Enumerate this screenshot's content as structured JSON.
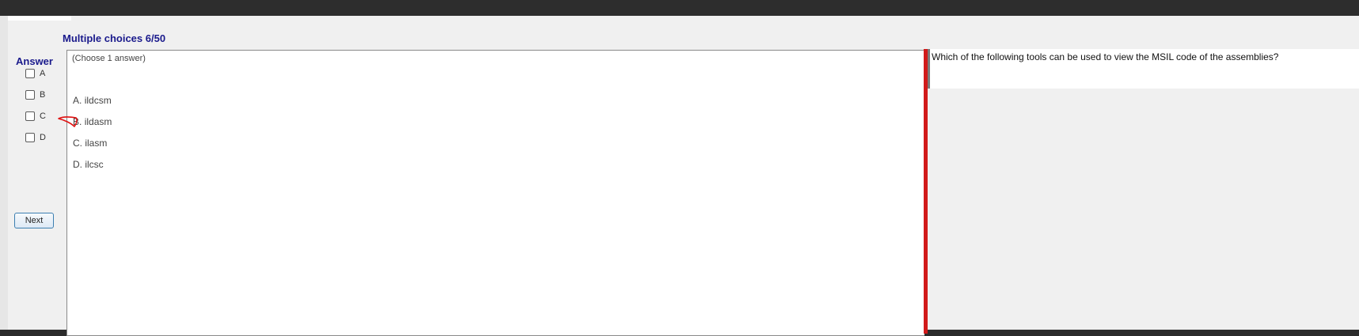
{
  "header": {
    "title": "Multiple choices 6/50"
  },
  "answer_panel": {
    "label": "Answer",
    "options": [
      "A",
      "B",
      "C",
      "D"
    ],
    "next_label": "Next"
  },
  "question": {
    "instruction": "(Choose 1 answer)",
    "choices": [
      {
        "letter": "A.",
        "text": "ildcsm"
      },
      {
        "letter": "B.",
        "text": "ildasm"
      },
      {
        "letter": "C.",
        "text": "ilasm"
      },
      {
        "letter": "D.",
        "text": "ilcsc"
      }
    ],
    "prompt": "Which of the following tools can be used to view the MSIL code of the assemblies?"
  },
  "colors": {
    "title": "#1a1a8c",
    "divider": "#d11a1a",
    "annotation": "#e01010"
  }
}
